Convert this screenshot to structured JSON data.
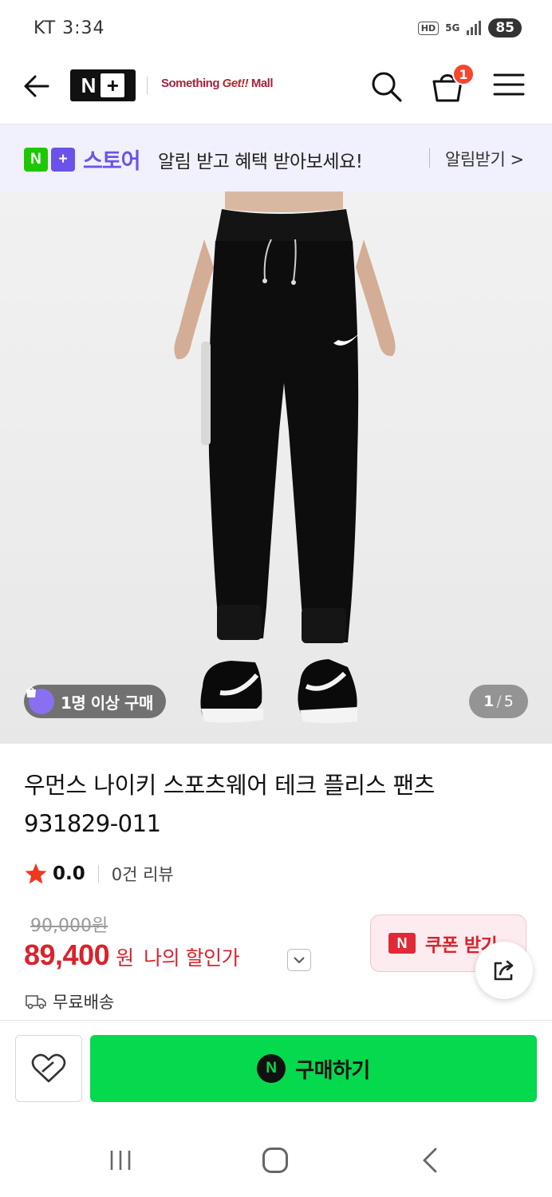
{
  "status_bar": {
    "time": "KT 3:34",
    "hd_label": "HD",
    "network_label": "5G",
    "battery": "85"
  },
  "header": {
    "logo_n": "N",
    "logo_plus": "+",
    "mall_name_prefix": "Something ",
    "mall_name_highlight": "Get!!",
    "mall_name_suffix": " Mall",
    "cart_count": "1"
  },
  "notice": {
    "store_n": "N",
    "store_plus": "+",
    "store_name": "스토어",
    "message": "알림 받고 혜택 받아보세요!",
    "action_label": "알림받기 >"
  },
  "gallery": {
    "badge_text": "1명 이상 구매",
    "current": "1",
    "separator": "/",
    "total": "5"
  },
  "product": {
    "title": "우먼스 나이키 스포츠웨어 테크 플리스 팬츠 931829-011",
    "rating": "0.0",
    "review_count": "0건 리뷰",
    "original_price": "90,000원",
    "sale_price": "89,400",
    "currency": "원",
    "discount_label": "나의 할인가",
    "coupon_n": "N",
    "coupon_label": "쿠폰 받기",
    "shipping": "무료배송"
  },
  "actions": {
    "buy_n": "N",
    "buy_label": "구매하기"
  },
  "colors": {
    "naver_green": "#05d94e",
    "plus_purple": "#6b53e8",
    "price_red": "#d8232d",
    "cart_badge": "#f5462f"
  },
  "icons": [
    "back-arrow-icon",
    "search-icon",
    "cart-icon",
    "menu-icon",
    "chevron-right-icon",
    "bag-icon",
    "star-icon",
    "chevron-down-icon",
    "share-icon",
    "truck-icon",
    "heart-icon",
    "nav-recent-icon",
    "nav-home-icon",
    "nav-back-icon"
  ]
}
